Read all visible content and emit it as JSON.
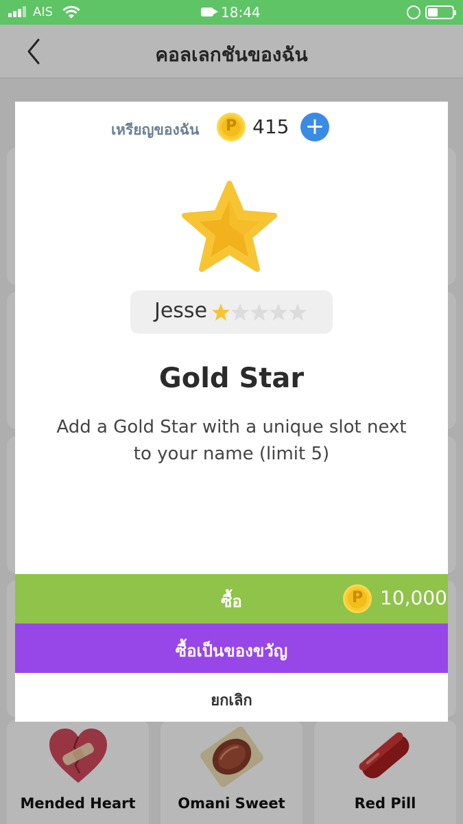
{
  "status_bar": {
    "carrier": "AIS",
    "time": "18:44"
  },
  "nav": {
    "title": "คอลเลกชันของฉัน"
  },
  "modal": {
    "coin_label": "เหรียญของฉัน",
    "coin_balance": "415",
    "item": {
      "preview_name": "Jesse",
      "preview_star_rating": 1,
      "preview_star_max": 5,
      "title": "Gold Star",
      "description": "Add a Gold Star with a unique slot next to your name (limit 5)"
    },
    "buy": {
      "label": "ซื้อ",
      "price": "10,000"
    },
    "gift": {
      "label": "ซื้อเป็นของขวัญ"
    },
    "cancel": {
      "label": "ยกเลิก"
    }
  },
  "background_items": [
    {
      "name": "Mended Heart",
      "icon": "mended-heart-icon"
    },
    {
      "name": "Omani Sweet",
      "icon": "omani-sweet-icon"
    },
    {
      "name": "Red Pill",
      "icon": "red-pill-icon"
    }
  ],
  "colors": {
    "status_bar": "#5ec465",
    "buy_button": "#8fc34a",
    "gift_button": "#9747e8",
    "plus_button": "#3b8ae6",
    "coin": "#f3bd1a",
    "star": "#f7c534"
  }
}
